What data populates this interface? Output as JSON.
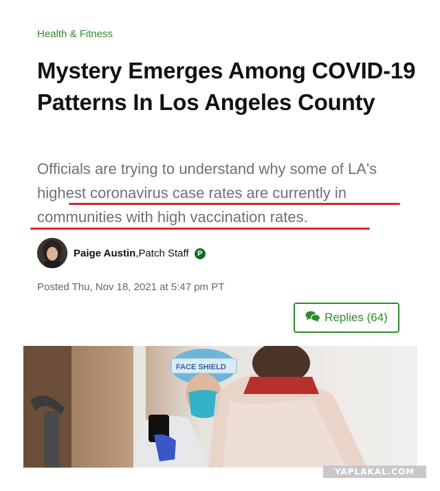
{
  "article": {
    "category": "Health & Fitness",
    "headline": "Mystery Emerges Among COVID-19 Patterns In Los Angeles County",
    "subheadline": "Officials are trying to understand why some of LA's highest coronavirus case rates are currently in communities with high vaccination rates.",
    "author": {
      "name": "Paige Austin",
      "role": ",Patch Staff",
      "badge": "P"
    },
    "posted": "Posted Thu, Nov 18, 2021 at 5:47 pm PT",
    "replies_label": "Replies (64)",
    "photo": {
      "shield_text": "FACE SHIELD"
    }
  },
  "watermark": "YAPLAKAL.COM",
  "colors": {
    "accent_green": "#2f8a2b",
    "underline_red": "#d92626",
    "subhead_gray": "#707070"
  },
  "icons": {
    "replies": "chat-bubbles-icon"
  }
}
